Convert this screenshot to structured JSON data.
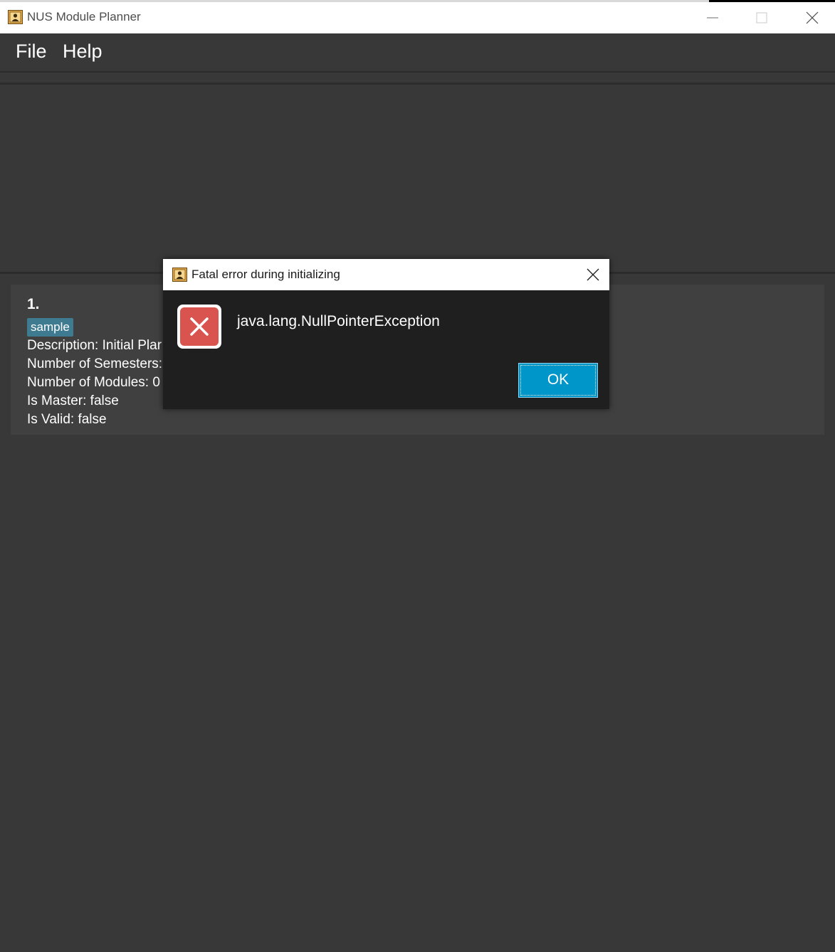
{
  "window": {
    "title": "NUS Module Planner"
  },
  "menu": {
    "items": [
      "File",
      "Help"
    ]
  },
  "plan_card": {
    "index": "1.",
    "tag": "sample",
    "description": "Description: Initial Plar",
    "semesters": "Number of Semesters:",
    "modules": "Number of Modules: 0",
    "is_master": "Is Master: false",
    "is_valid": "Is Valid: false"
  },
  "dialog": {
    "title": "Fatal error during initializing",
    "message": "java.lang.NullPointerException",
    "ok_label": "OK",
    "icon": "error-icon"
  },
  "icons": {
    "app": "app-icon",
    "minimize": "minimize-icon",
    "maximize": "maximize-icon",
    "close": "close-icon"
  },
  "colors": {
    "background": "#383838",
    "tag": "#3e7b91",
    "accent_button": "#0096c9",
    "error_red": "#d9534f"
  }
}
